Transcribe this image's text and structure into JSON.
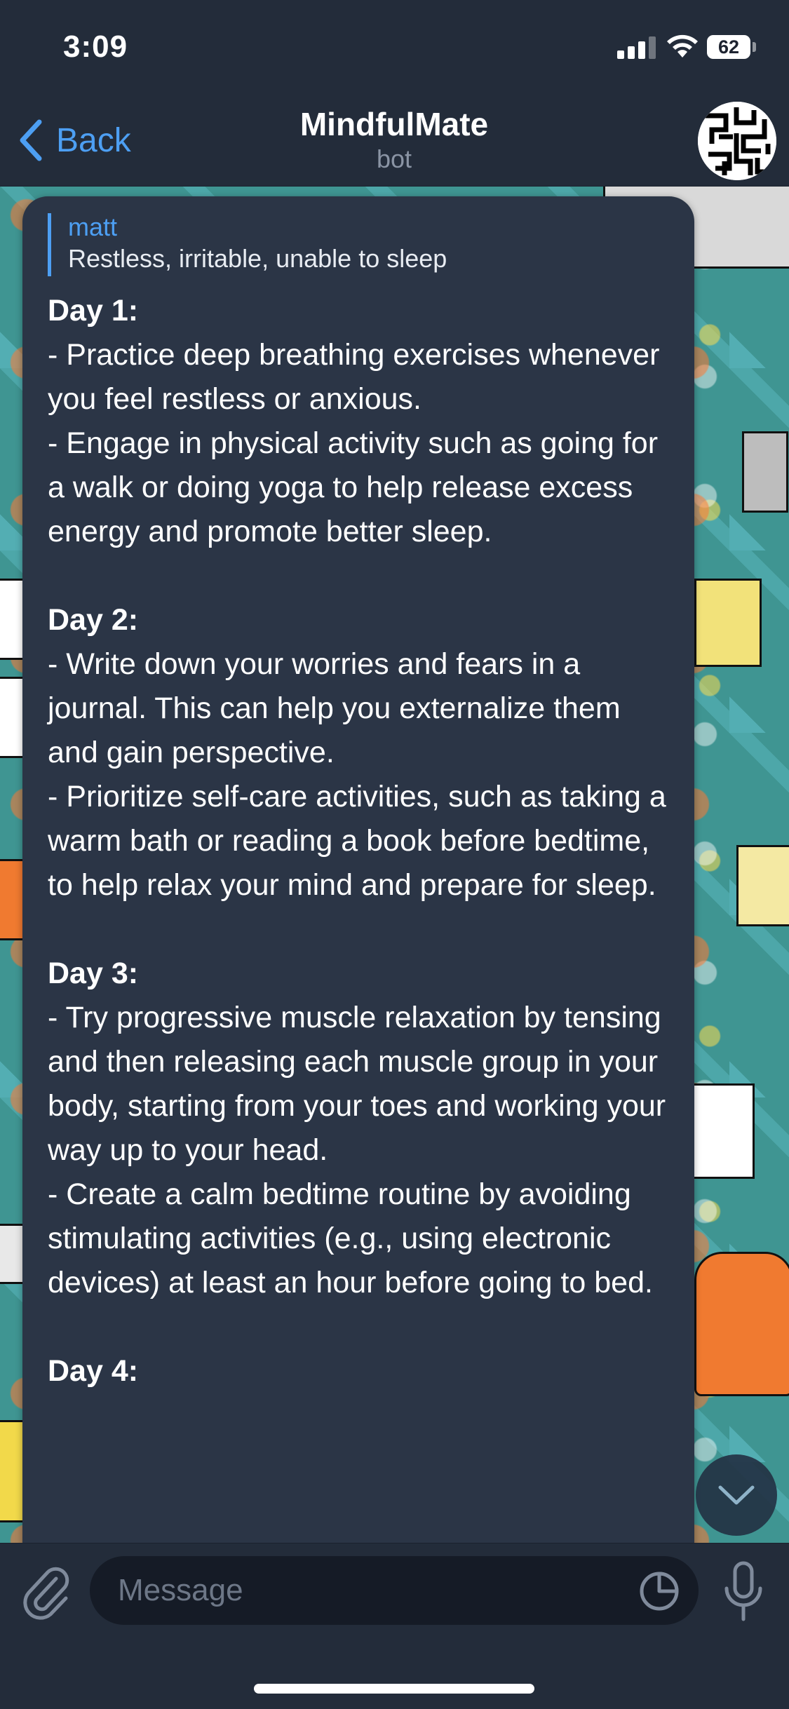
{
  "status_bar": {
    "time": "3:09",
    "battery_level": "62",
    "signal_bars_active": 3,
    "signal_bars_total": 4
  },
  "header": {
    "back_label": "Back",
    "title": "MindfulMate",
    "subtitle": "bot",
    "back_icon": "chevron-left-icon",
    "avatar_icon": "maze-avatar"
  },
  "message": {
    "reply": {
      "author": "matt",
      "text": "Restless, irritable, unable to sleep"
    },
    "days": [
      {
        "title": "Day 1:",
        "tips": [
          "- Practice deep breathing exercises whenever you feel restless or anxious.",
          "- Engage in physical activity such as going for a walk or doing yoga to help release excess energy and promote better sleep."
        ]
      },
      {
        "title": "Day 2:",
        "tips": [
          "- Write down your worries and fears in a journal. This can help you externalize them and gain perspective.",
          "- Prioritize self-care activities, such as taking a warm bath or reading a book before bedtime, to help relax your mind and prepare for sleep."
        ]
      },
      {
        "title": "Day 3:",
        "tips": [
          "- Try progressive muscle relaxation by tensing and then releasing each muscle group in your body, starting from your toes and working your way up to your head.",
          "- Create a calm bedtime routine by avoiding stimulating activities (e.g., using electronic devices) at least an hour before going to bed."
        ]
      },
      {
        "title": "Day 4:",
        "tips": []
      }
    ]
  },
  "input_bar": {
    "placeholder": "Message",
    "value": "",
    "attach_icon": "paperclip-icon",
    "sticker_icon": "sticker-icon",
    "mic_icon": "microphone-icon"
  },
  "scroll_down_icon": "chevron-down-icon",
  "colors": {
    "accent": "#4d9ff3",
    "header_bg": "#232c3a",
    "bubble_bg": "#2b3546",
    "wallpaper": "#3f9592"
  }
}
